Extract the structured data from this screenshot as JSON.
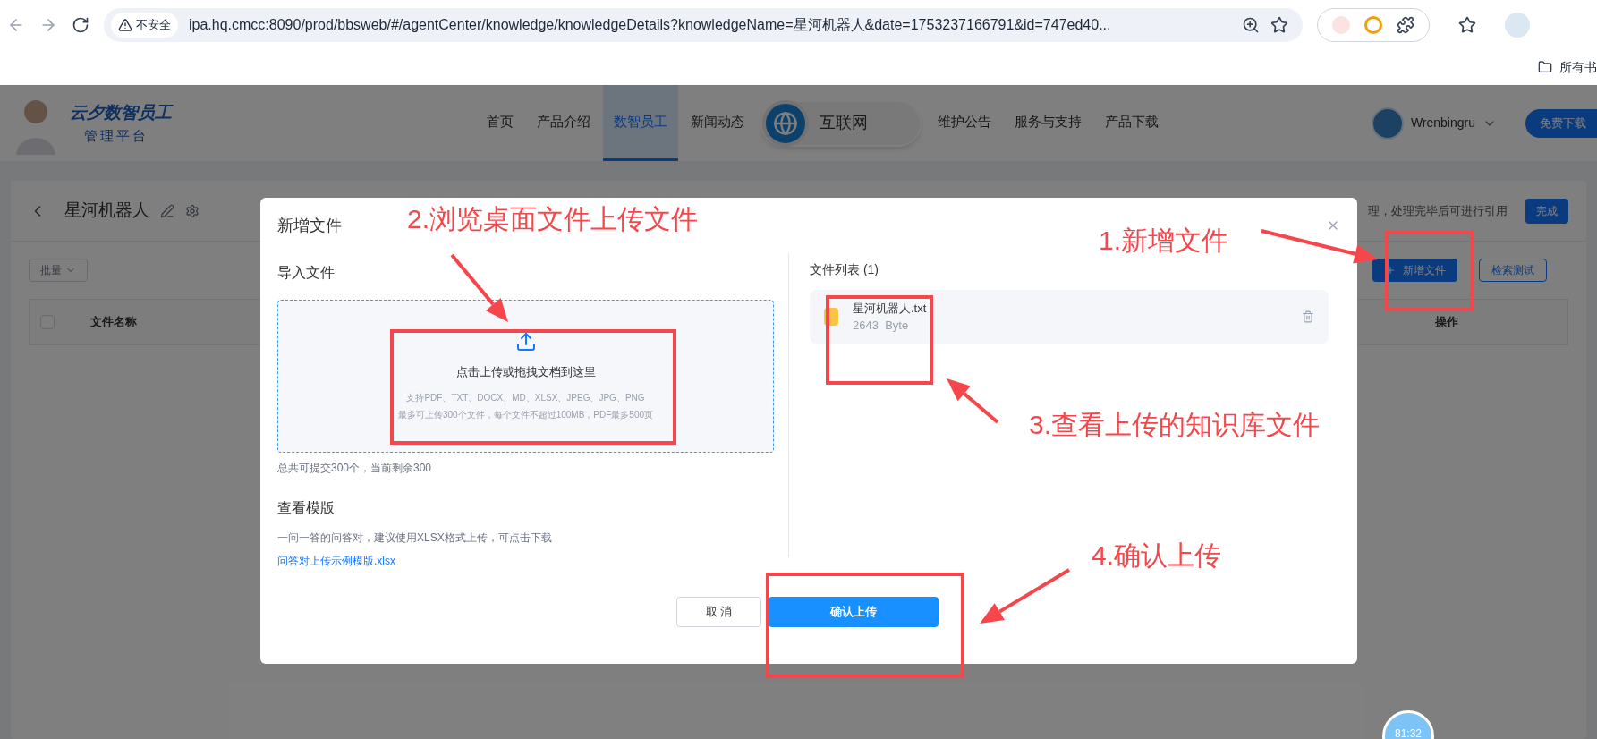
{
  "browser": {
    "security_label": "不安全",
    "url": "ipa.hq.cmcc:8090/prod/bbsweb/#/agentCenter/knowledge/knowledgeDetails?knowledgeName=星河机器人&date=1753237166791&id=747ed40...",
    "bookmark": "所有书"
  },
  "header": {
    "brand": "云夕数智员工",
    "subtitle": "管理平台",
    "nav": [
      {
        "label": "首页",
        "selected": false
      },
      {
        "label": "产品介绍",
        "selected": false
      },
      {
        "label": "数智员工",
        "selected": true
      },
      {
        "label": "新闻动态",
        "selected": false
      },
      {
        "label": "维护公告",
        "selected": false
      },
      {
        "label": "服务与支持",
        "selected": false
      },
      {
        "label": "产品下载",
        "selected": false
      }
    ],
    "user": "Wrenbingru",
    "download_button": "免费下载"
  },
  "floating_badge": "互联网",
  "page": {
    "title": "星河机器人",
    "notice": "理，处理完毕后可进行引用",
    "done_button": "完成",
    "batch_dropdown": "批量",
    "add_button": "新增文件",
    "test_button": "检索测试",
    "columns": [
      "文件名称",
      "操作"
    ],
    "select_all": {
      "checked": false
    }
  },
  "dialog": {
    "title": "新增文件",
    "import_heading": "导入文件",
    "dropzone": {
      "prompt": "点击上传或拖拽文档到这里",
      "formats": "支持PDF、TXT、DOCX、MD、XLSX、JPEG、JPG、PNG",
      "limits": "最多可上传300个文件，每个文件不超过100MB，PDF最多500页"
    },
    "quota": "总共可提交300个，当前剩余300",
    "template_heading": "查看模版",
    "template_hint": "一问一答的问答对，建议使用XLSX格式上传，可点击下载",
    "template_link": "问答对上传示例模版.xlsx",
    "file_list_heading": "文件列表 (1)",
    "files": [
      {
        "name": "星河机器人.txt",
        "size": "2643  Byte"
      }
    ],
    "cancel_button": "取 消",
    "confirm_button": "确认上传"
  },
  "annotations": [
    {
      "label": "2.浏览桌面文件上传文件"
    },
    {
      "label": "1.新增文件"
    },
    {
      "label": "3.查看上传的知识库文件"
    },
    {
      "label": "4.确认上传"
    }
  ],
  "timer": "81:32"
}
